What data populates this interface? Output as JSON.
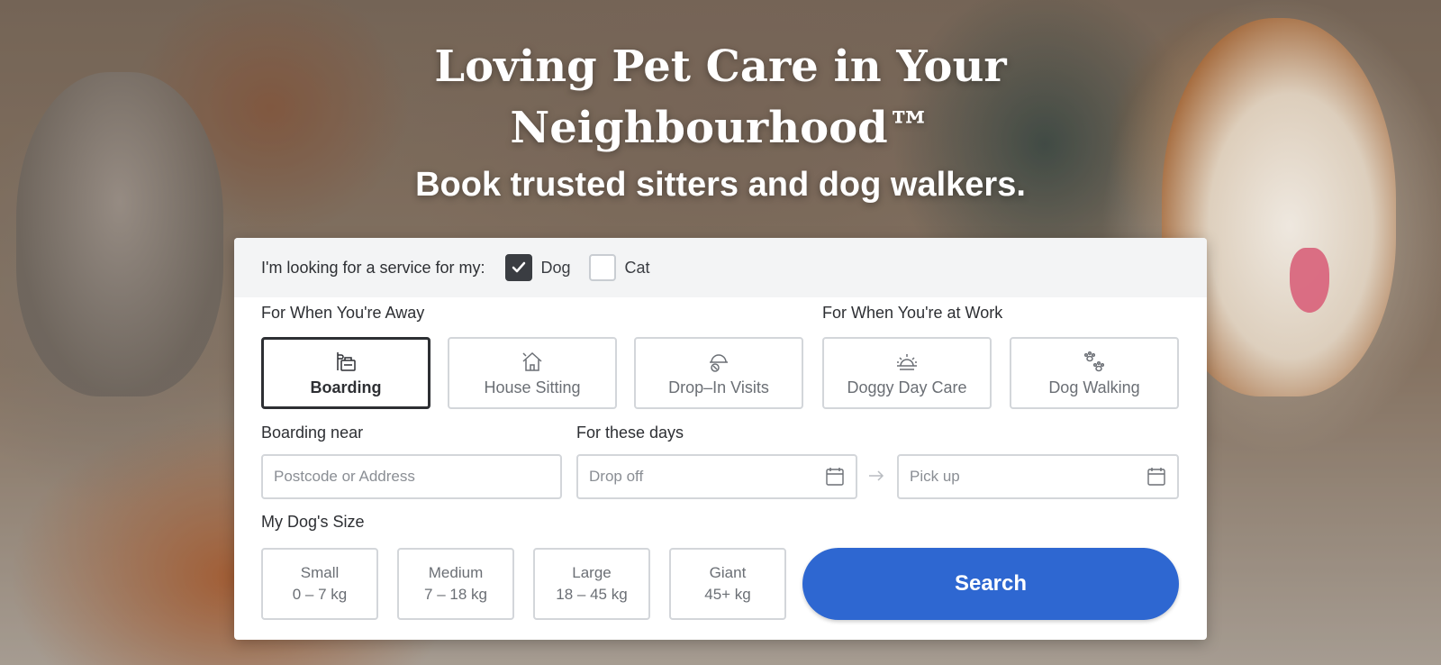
{
  "hero": {
    "title": "Loving Pet Care in Your Neighbourhood™",
    "subtitle": "Book trusted sitters and dog walkers."
  },
  "pet_selector": {
    "question": "I'm looking for a service for my:",
    "options": [
      {
        "label": "Dog",
        "checked": true
      },
      {
        "label": "Cat",
        "checked": false
      }
    ]
  },
  "services": {
    "away_heading": "For When You're Away",
    "work_heading": "For When You're at Work",
    "items": [
      {
        "label": "Boarding",
        "icon": "boarding-icon",
        "selected": true
      },
      {
        "label": "House Sitting",
        "icon": "house-sitting-icon",
        "selected": false
      },
      {
        "label": "Drop–In Visits",
        "icon": "drop-in-visits-icon",
        "selected": false
      },
      {
        "label": "Doggy Day Care",
        "icon": "sun-icon",
        "selected": false
      },
      {
        "label": "Dog Walking",
        "icon": "paw-icon",
        "selected": false
      }
    ]
  },
  "location": {
    "label": "Boarding near",
    "placeholder": "Postcode or Address"
  },
  "dates": {
    "label": "For these days",
    "drop_off_placeholder": "Drop off",
    "pick_up_placeholder": "Pick up"
  },
  "dog_size": {
    "label": "My Dog's Size",
    "options": [
      {
        "name": "Small",
        "range": "0 – 7 kg"
      },
      {
        "name": "Medium",
        "range": "7 – 18 kg"
      },
      {
        "name": "Large",
        "range": "18 – 45 kg"
      },
      {
        "name": "Giant",
        "range": "45+ kg"
      }
    ]
  },
  "search_button": "Search",
  "colors": {
    "primary_button": "#2e67d1",
    "checkbox_checked": "#3a3d42",
    "text_dark": "#2d2f33"
  }
}
